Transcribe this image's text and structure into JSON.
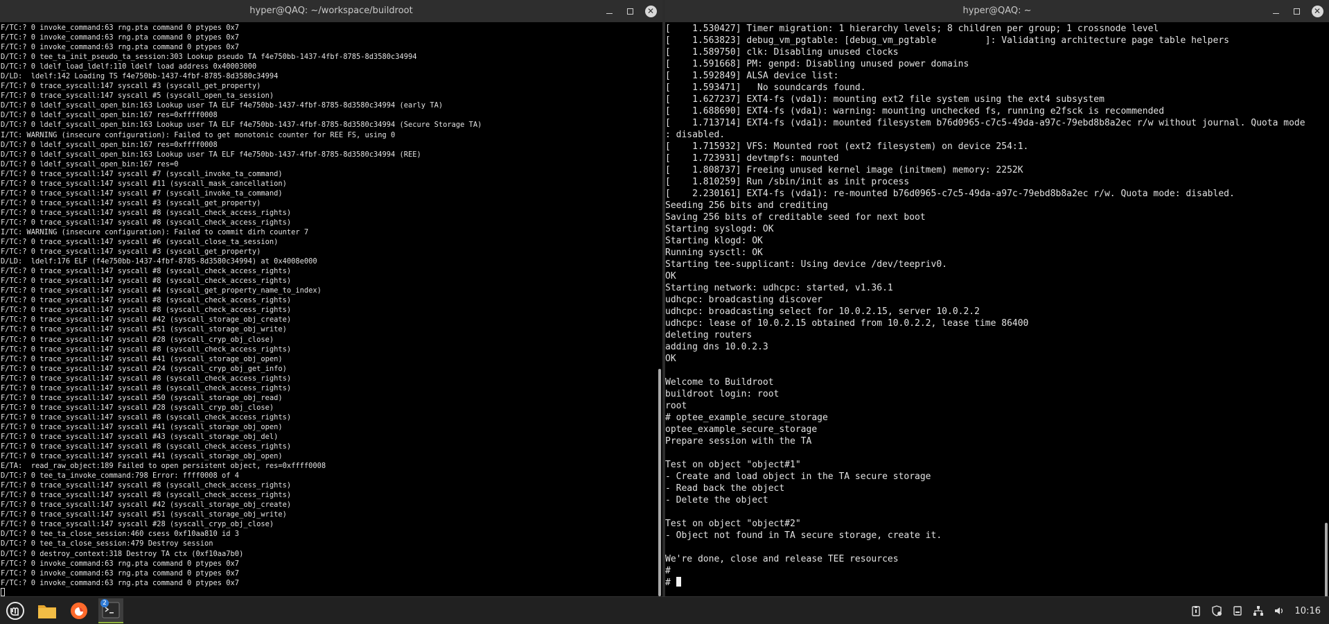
{
  "left_window": {
    "title": "hyper@QAQ: ~/workspace/buildroot",
    "lines": [
      "F/TC:? 0 invoke_command:63 rng.pta command 0 ptypes 0x7",
      "F/TC:? 0 invoke_command:63 rng.pta command 0 ptypes 0x7",
      "F/TC:? 0 invoke_command:63 rng.pta command 0 ptypes 0x7",
      "D/TC:? 0 tee_ta_init_pseudo_ta_session:303 Lookup pseudo TA f4e750bb-1437-4fbf-8785-8d3580c34994",
      "D/TC:? 0 ldelf_load_ldelf:110 ldelf load address 0x40003000",
      "D/LD:  ldelf:142 Loading TS f4e750bb-1437-4fbf-8785-8d3580c34994",
      "F/TC:? 0 trace_syscall:147 syscall #3 (syscall_get_property)",
      "F/TC:? 0 trace_syscall:147 syscall #5 (syscall_open_ta_session)",
      "D/TC:? 0 ldelf_syscall_open_bin:163 Lookup user TA ELF f4e750bb-1437-4fbf-8785-8d3580c34994 (early TA)",
      "D/TC:? 0 ldelf_syscall_open_bin:167 res=0xffff0008",
      "D/TC:? 0 ldelf_syscall_open_bin:163 Lookup user TA ELF f4e750bb-1437-4fbf-8785-8d3580c34994 (Secure Storage TA)",
      "I/TC: WARNING (insecure configuration): Failed to get monotonic counter for REE FS, using 0",
      "D/TC:? 0 ldelf_syscall_open_bin:167 res=0xffff0008",
      "D/TC:? 0 ldelf_syscall_open_bin:163 Lookup user TA ELF f4e750bb-1437-4fbf-8785-8d3580c34994 (REE)",
      "D/TC:? 0 ldelf_syscall_open_bin:167 res=0",
      "F/TC:? 0 trace_syscall:147 syscall #7 (syscall_invoke_ta_command)",
      "F/TC:? 0 trace_syscall:147 syscall #11 (syscall_mask_cancellation)",
      "F/TC:? 0 trace_syscall:147 syscall #7 (syscall_invoke_ta_command)",
      "F/TC:? 0 trace_syscall:147 syscall #3 (syscall_get_property)",
      "F/TC:? 0 trace_syscall:147 syscall #8 (syscall_check_access_rights)",
      "F/TC:? 0 trace_syscall:147 syscall #8 (syscall_check_access_rights)",
      "I/TC: WARNING (insecure configuration): Failed to commit dirh counter 7",
      "F/TC:? 0 trace_syscall:147 syscall #6 (syscall_close_ta_session)",
      "F/TC:? 0 trace_syscall:147 syscall #3 (syscall_get_property)",
      "D/LD:  ldelf:176 ELF (f4e750bb-1437-4fbf-8785-8d3580c34994) at 0x4008e000",
      "F/TC:? 0 trace_syscall:147 syscall #8 (syscall_check_access_rights)",
      "F/TC:? 0 trace_syscall:147 syscall #8 (syscall_check_access_rights)",
      "F/TC:? 0 trace_syscall:147 syscall #4 (syscall_get_property_name_to_index)",
      "F/TC:? 0 trace_syscall:147 syscall #8 (syscall_check_access_rights)",
      "F/TC:? 0 trace_syscall:147 syscall #8 (syscall_check_access_rights)",
      "F/TC:? 0 trace_syscall:147 syscall #42 (syscall_storage_obj_create)",
      "F/TC:? 0 trace_syscall:147 syscall #51 (syscall_storage_obj_write)",
      "F/TC:? 0 trace_syscall:147 syscall #28 (syscall_cryp_obj_close)",
      "F/TC:? 0 trace_syscall:147 syscall #8 (syscall_check_access_rights)",
      "F/TC:? 0 trace_syscall:147 syscall #41 (syscall_storage_obj_open)",
      "F/TC:? 0 trace_syscall:147 syscall #24 (syscall_cryp_obj_get_info)",
      "F/TC:? 0 trace_syscall:147 syscall #8 (syscall_check_access_rights)",
      "F/TC:? 0 trace_syscall:147 syscall #8 (syscall_check_access_rights)",
      "F/TC:? 0 trace_syscall:147 syscall #50 (syscall_storage_obj_read)",
      "F/TC:? 0 trace_syscall:147 syscall #28 (syscall_cryp_obj_close)",
      "F/TC:? 0 trace_syscall:147 syscall #8 (syscall_check_access_rights)",
      "F/TC:? 0 trace_syscall:147 syscall #41 (syscall_storage_obj_open)",
      "F/TC:? 0 trace_syscall:147 syscall #43 (syscall_storage_obj_del)",
      "F/TC:? 0 trace_syscall:147 syscall #8 (syscall_check_access_rights)",
      "F/TC:? 0 trace_syscall:147 syscall #41 (syscall_storage_obj_open)",
      "E/TA:  read_raw_object:189 Failed to open persistent object, res=0xffff0008",
      "D/TC:? 0 tee_ta_invoke_command:798 Error: ffff0008 of 4",
      "F/TC:? 0 trace_syscall:147 syscall #8 (syscall_check_access_rights)",
      "F/TC:? 0 trace_syscall:147 syscall #8 (syscall_check_access_rights)",
      "F/TC:? 0 trace_syscall:147 syscall #42 (syscall_storage_obj_create)",
      "F/TC:? 0 trace_syscall:147 syscall #51 (syscall_storage_obj_write)",
      "F/TC:? 0 trace_syscall:147 syscall #28 (syscall_cryp_obj_close)",
      "D/TC:? 0 tee_ta_close_session:460 csess 0xf10aa810 id 3",
      "D/TC:? 0 tee_ta_close_session:479 Destroy session",
      "D/TC:? 0 destroy_context:318 Destroy TA ctx (0xf10aa7b0)",
      "F/TC:? 0 invoke_command:63 rng.pta command 0 ptypes 0x7",
      "F/TC:? 0 invoke_command:63 rng.pta command 0 ptypes 0x7",
      "F/TC:? 0 invoke_command:63 rng.pta command 0 ptypes 0x7"
    ]
  },
  "right_window": {
    "title": "hyper@QAQ: ~",
    "lines": [
      "[    1.530427] Timer migration: 1 hierarchy levels; 8 children per group; 1 crossnode level",
      "[    1.563823] debug_vm_pgtable: [debug_vm_pgtable         ]: Validating architecture page table helpers",
      "[    1.589750] clk: Disabling unused clocks",
      "[    1.591668] PM: genpd: Disabling unused power domains",
      "[    1.592849] ALSA device list:",
      "[    1.593471]   No soundcards found.",
      "[    1.627237] EXT4-fs (vda1): mounting ext2 file system using the ext4 subsystem",
      "[    1.688690] EXT4-fs (vda1): warning: mounting unchecked fs, running e2fsck is recommended",
      "[    1.713714] EXT4-fs (vda1): mounted filesystem b76d0965-c7c5-49da-a97c-79ebd8b8a2ec r/w without journal. Quota mode",
      ": disabled.",
      "[    1.715932] VFS: Mounted root (ext2 filesystem) on device 254:1.",
      "[    1.723931] devtmpfs: mounted",
      "[    1.808737] Freeing unused kernel image (initmem) memory: 2252K",
      "[    1.810259] Run /sbin/init as init process",
      "[    2.230161] EXT4-fs (vda1): re-mounted b76d0965-c7c5-49da-a97c-79ebd8b8a2ec r/w. Quota mode: disabled.",
      "Seeding 256 bits and crediting",
      "Saving 256 bits of creditable seed for next boot",
      "Starting syslogd: OK",
      "Starting klogd: OK",
      "Running sysctl: OK",
      "Starting tee-supplicant: Using device /dev/teepriv0.",
      "OK",
      "Starting network: udhcpc: started, v1.36.1",
      "udhcpc: broadcasting discover",
      "udhcpc: broadcasting select for 10.0.2.15, server 10.0.2.2",
      "udhcpc: lease of 10.0.2.15 obtained from 10.0.2.2, lease time 86400",
      "deleting routers",
      "adding dns 10.0.2.3",
      "OK",
      "",
      "Welcome to Buildroot",
      "buildroot login: root",
      "root",
      "# optee_example_secure_storage",
      "optee_example_secure_storage",
      "Prepare session with the TA",
      "",
      "Test on object \"object#1\"",
      "- Create and load object in the TA secure storage",
      "- Read back the object",
      "- Delete the object",
      "",
      "Test on object \"object#2\"",
      "- Object not found in TA secure storage, create it.",
      "",
      "We're done, close and release TEE resources",
      "#"
    ],
    "prompt": "# "
  },
  "taskbar": {
    "terminal_badge": "2",
    "clock": "10:16"
  },
  "colors": {
    "terminal_bg": "#000000",
    "terminal_fg": "#e2e2e2",
    "titlebar_bg": "#2e2e2e",
    "taskbar_bg": "#212121",
    "accent": "#8fb43a"
  }
}
